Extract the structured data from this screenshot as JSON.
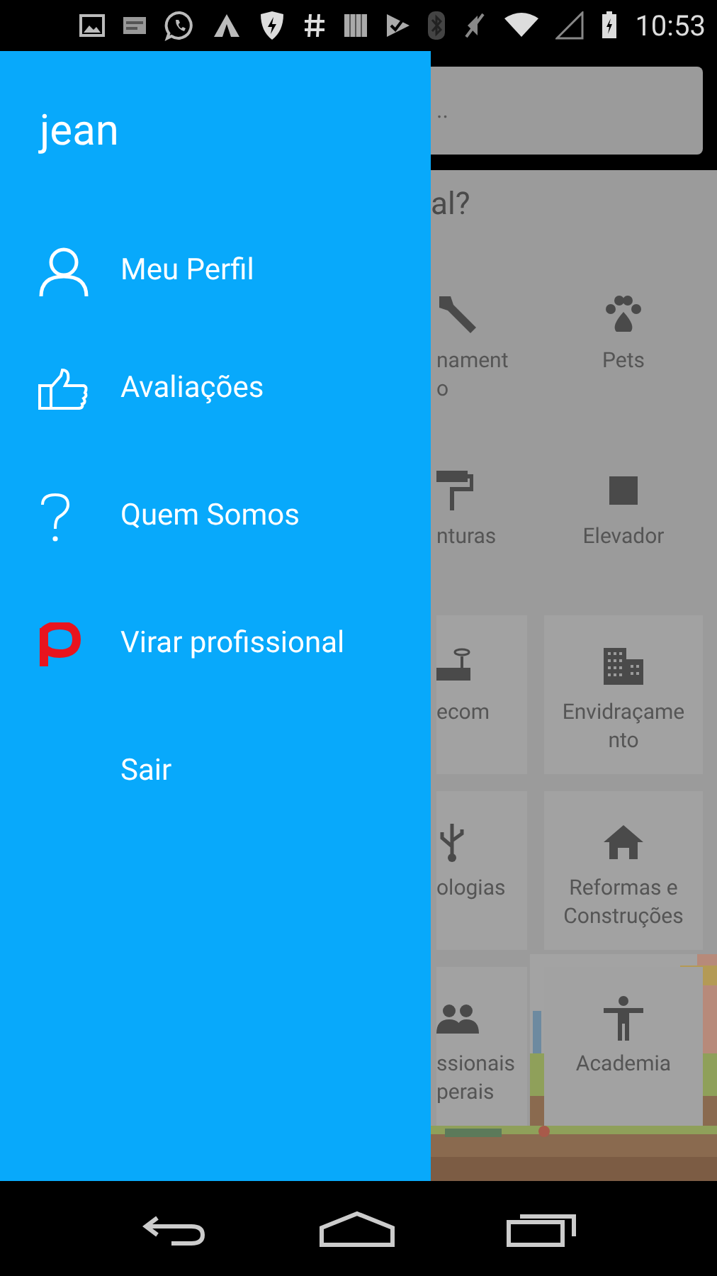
{
  "status_bar": {
    "time": "10:53"
  },
  "drawer": {
    "user_name": "jean",
    "items": [
      {
        "kind": "person",
        "label": "Meu Perfil"
      },
      {
        "kind": "thumb",
        "label": "Avaliações"
      },
      {
        "kind": "question",
        "label": "Quem Somos"
      },
      {
        "kind": "brand",
        "label": "Virar profissional"
      },
      {
        "kind": "plain",
        "label": "Sair"
      }
    ]
  },
  "background": {
    "search_placeholder": "..",
    "heading": "al?",
    "categories": [
      {
        "kind": "wrench",
        "lines": [
          "nament",
          "o"
        ]
      },
      {
        "kind": "paw",
        "lines": [
          "Pets"
        ]
      },
      {
        "kind": "roller",
        "lines": [
          "nturas"
        ]
      },
      {
        "kind": "square",
        "lines": [
          "Elevador"
        ]
      },
      {
        "kind": "router",
        "lines": [
          "ecom"
        ]
      },
      {
        "kind": "building",
        "lines": [
          "Envidraçame",
          "nto"
        ]
      },
      {
        "kind": "usb",
        "lines": [
          "ologias"
        ]
      },
      {
        "kind": "home",
        "lines": [
          "Reformas e",
          "Construções"
        ]
      },
      {
        "kind": "people",
        "lines": [
          "ssionais",
          "perais"
        ]
      },
      {
        "kind": "figure",
        "lines": [
          "Academia"
        ]
      }
    ]
  }
}
